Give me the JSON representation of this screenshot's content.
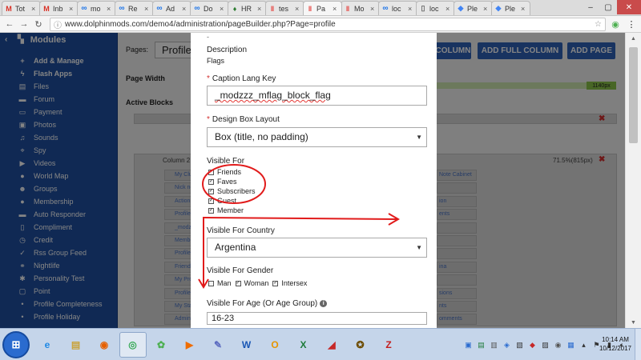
{
  "browser": {
    "tabs": [
      {
        "label": "Tot",
        "favicon": "gmail",
        "glyph": "M"
      },
      {
        "label": "Inb",
        "favicon": "gmail",
        "glyph": "M"
      },
      {
        "label": "mo",
        "favicon": "infinity",
        "glyph": "∞"
      },
      {
        "label": "Re",
        "favicon": "infinity",
        "glyph": "∞"
      },
      {
        "label": "Ad",
        "favicon": "infinity",
        "glyph": "∞"
      },
      {
        "label": "Do",
        "favicon": "infinity",
        "glyph": "∞"
      },
      {
        "label": "HR",
        "favicon": "green",
        "glyph": "♦"
      },
      {
        "label": "tes",
        "favicon": "red",
        "glyph": "‖"
      },
      {
        "label": "Pa",
        "favicon": "red",
        "glyph": "‖",
        "active": true
      },
      {
        "label": "Mo",
        "favicon": "red",
        "glyph": "‖"
      },
      {
        "label": "loc",
        "favicon": "infinity",
        "glyph": "∞"
      },
      {
        "label": "loc",
        "favicon": "doc",
        "glyph": "▯"
      },
      {
        "label": "Ple",
        "favicon": "plesk",
        "glyph": "◆"
      },
      {
        "label": "Ple",
        "favicon": "plesk",
        "glyph": "◆"
      }
    ],
    "tab_close_glyph": "×",
    "url": "www.dolphinmods.com/demo4/administration/pageBuilder.php?Page=profile"
  },
  "sidebar": {
    "title": "Modules",
    "items": [
      {
        "label": "Add & Manage",
        "icon": "plus-icon",
        "glyph": "+",
        "strong": true
      },
      {
        "label": "Flash Apps",
        "icon": "bolt-icon",
        "glyph": "ϟ",
        "strong": true
      },
      {
        "label": "Files",
        "icon": "file-icon",
        "glyph": "▤"
      },
      {
        "label": "Forum",
        "icon": "forum-icon",
        "glyph": "▬"
      },
      {
        "label": "Payment",
        "icon": "card-icon",
        "glyph": "▭"
      },
      {
        "label": "Photos",
        "icon": "photo-icon",
        "glyph": "▣"
      },
      {
        "label": "Sounds",
        "icon": "music-icon",
        "glyph": "♫"
      },
      {
        "label": "Spy",
        "icon": "crosshair-icon",
        "glyph": "⌖"
      },
      {
        "label": "Videos",
        "icon": "video-icon",
        "glyph": "▶"
      },
      {
        "label": "World Map",
        "icon": "map-marker-icon",
        "glyph": "●"
      },
      {
        "label": "Groups",
        "icon": "group-icon",
        "glyph": "☻"
      },
      {
        "label": "Membership",
        "icon": "circle-icon",
        "glyph": "●"
      },
      {
        "label": "Auto Responder",
        "icon": "reply-icon",
        "glyph": "▬"
      },
      {
        "label": "Compliment",
        "icon": "compliment-icon",
        "glyph": "▯"
      },
      {
        "label": "Credit",
        "icon": "credit-icon",
        "glyph": "◷"
      },
      {
        "label": "Rss Group Feed",
        "icon": "check-icon",
        "glyph": "✓"
      },
      {
        "label": "Nightlife",
        "icon": "link-icon",
        "glyph": "⚭"
      },
      {
        "label": "Personality Test",
        "icon": "asterisk-icon",
        "glyph": "✱"
      },
      {
        "label": "Point",
        "icon": "point-icon",
        "glyph": "▢"
      },
      {
        "label": "Profile Completeness",
        "icon": "dot-icon",
        "glyph": "•"
      },
      {
        "label": "Profile Holiday",
        "icon": "dot-icon",
        "glyph": "•"
      }
    ]
  },
  "builder": {
    "pages_label": "Pages:",
    "pages_value": "Profile",
    "page_width_label": "Page Width",
    "active_blocks_label": "Active Blocks",
    "add_column_button": "COLUMN",
    "add_full_column_button": "ADD FULL COLUMN",
    "add_page_button": "ADD PAGE",
    "width_badge": "1140px",
    "remove_glyph": "✖",
    "column_left_label": "Column 2 (",
    "column_right_label": "71.5%(815px)",
    "mini_blocks_left": [
      "My Clu",
      "Nick ne",
      "Actions",
      "Profile Fl",
      "_modzz",
      "Member",
      "Profile C",
      "Friend Re",
      "My Profi",
      "Profile C",
      "My Stati",
      "Admin"
    ],
    "mini_blocks_right": [
      "Note Cabinet",
      "",
      "ion",
      "ents",
      "",
      "",
      "",
      "ina",
      "",
      "sions",
      "nts",
      "omments"
    ]
  },
  "modal": {
    "top_partial_text": "-",
    "description_label": "Description",
    "description_value": "Flags",
    "caption_label": "Caption Lang Key",
    "caption_value": "_modzzz_mflag_block_flag",
    "design_box_label": "Design Box Layout",
    "design_box_value": "Box (title, no padding)",
    "visible_for_label": "Visible For",
    "visible_for": [
      {
        "label": "Friends",
        "checked": true
      },
      {
        "label": "Faves",
        "checked": true
      },
      {
        "label": "Subscribers",
        "checked": true
      },
      {
        "label": "Guest",
        "checked": true
      },
      {
        "label": "Member",
        "checked": true
      }
    ],
    "country_label": "Visible For Country",
    "country_value": "Argentina",
    "gender_label": "Visible For Gender",
    "gender": [
      {
        "label": "Man",
        "checked": false
      },
      {
        "label": "Woman",
        "checked": true
      },
      {
        "label": "Intersex",
        "checked": true
      }
    ],
    "age_label": "Visible For Age (Or Age Group)",
    "age_value": "16-23",
    "required_marker": "*",
    "checkmark": "✓",
    "info_glyph": "i"
  },
  "taskbar": {
    "start_glyph": "⊞",
    "apps": [
      {
        "name": "internet-explorer",
        "glyph": "e",
        "color": "#1e88e5"
      },
      {
        "name": "file-explorer",
        "glyph": "▤",
        "color": "#c9a23a"
      },
      {
        "name": "firefox",
        "glyph": "◉",
        "color": "#e66000"
      },
      {
        "name": "chrome",
        "glyph": "◎",
        "color": "#34a853",
        "active": true
      },
      {
        "name": "frog-app",
        "glyph": "✿",
        "color": "#4caf50"
      },
      {
        "name": "media-player",
        "glyph": "▶",
        "color": "#ef6c00"
      },
      {
        "name": "paint",
        "glyph": "✎",
        "color": "#5c6bc0"
      },
      {
        "name": "word",
        "glyph": "W",
        "color": "#1a57b5"
      },
      {
        "name": "outlook",
        "glyph": "O",
        "color": "#e69500"
      },
      {
        "name": "excel",
        "glyph": "X",
        "color": "#1e7b3a"
      },
      {
        "name": "eraser-app",
        "glyph": "◢",
        "color": "#c62828"
      },
      {
        "name": "unknown-app",
        "glyph": "✪",
        "color": "#6d4c00"
      },
      {
        "name": "filezilla",
        "glyph": "Z",
        "color": "#c41e1e"
      }
    ],
    "time": "10:14 AM",
    "date": "10/12/2017"
  },
  "colors": {
    "sidebar_bg": "#1f4fa1",
    "button_bg": "#2f62b8",
    "annotation_red": "#e11b1b"
  }
}
